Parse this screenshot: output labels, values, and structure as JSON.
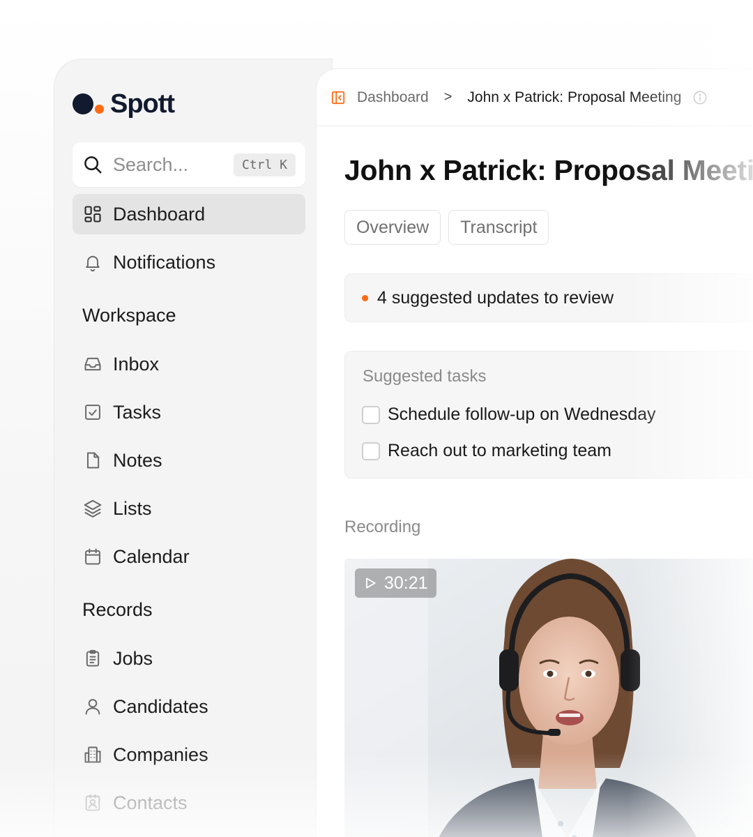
{
  "brand": {
    "name": "Spott",
    "colors": {
      "dark": "#111a2e",
      "accent": "#ff6a13"
    }
  },
  "search": {
    "placeholder": "Search...",
    "shortcut": "Ctrl K"
  },
  "nav": {
    "dashboard": {
      "label": "Dashboard",
      "icon": "dashboard-grid-icon",
      "active": true
    },
    "notifications": {
      "label": "Notifications",
      "icon": "bell-icon"
    }
  },
  "workspace": {
    "title": "Workspace",
    "items": [
      {
        "label": "Inbox",
        "icon": "inbox-icon"
      },
      {
        "label": "Tasks",
        "icon": "checkbox-icon"
      },
      {
        "label": "Notes",
        "icon": "document-icon"
      },
      {
        "label": "Lists",
        "icon": "layers-icon"
      },
      {
        "label": "Calendar",
        "icon": "calendar-icon"
      }
    ]
  },
  "records": {
    "title": "Records",
    "items": [
      {
        "label": "Jobs",
        "icon": "clipboard-icon"
      },
      {
        "label": "Candidates",
        "icon": "user-icon"
      },
      {
        "label": "Companies",
        "icon": "building-icon"
      },
      {
        "label": "Contacts",
        "icon": "contact-card-icon"
      }
    ]
  },
  "breadcrumb": {
    "root": "Dashboard",
    "separator": ">",
    "current": "John x Patrick: Proposal Meeting"
  },
  "page": {
    "title": "John x Patrick: Proposal Meeting",
    "tabs": [
      {
        "label": "Overview"
      },
      {
        "label": "Transcript"
      }
    ],
    "updates_banner": "4 suggested updates to review",
    "suggested_tasks": {
      "title": "Suggested tasks",
      "items": [
        {
          "label": "Schedule follow-up on Wednesday",
          "checked": false
        },
        {
          "label": "Reach out to marketing team",
          "checked": false
        }
      ]
    },
    "recording": {
      "label": "Recording",
      "duration": "30:21"
    }
  }
}
